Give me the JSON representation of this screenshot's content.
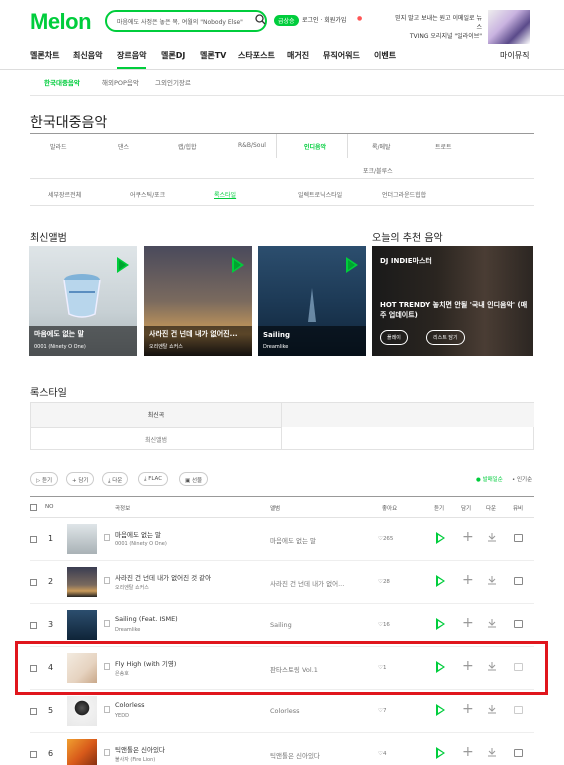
{
  "header": {
    "logo": "Melon",
    "search_text": "마음에도 사정은 놓은 목, 여월의 \"Nobody Else\"",
    "badge": "급상승",
    "login": "로그인 · 회원가입",
    "promo_line1": "믿지 말고 보내는 원고 이메일로 뉴스",
    "promo_line2": "TVING 오리지널 \"일라이브\""
  },
  "gnb": {
    "items": [
      "멜론차트",
      "최신음악",
      "장르음악",
      "멜론DJ",
      "멜론TV",
      "스타포스트",
      "매거진",
      "뮤직어워드",
      "이벤트"
    ],
    "right": "마이뮤직"
  },
  "sub_nav": [
    "한국대중음악",
    "해외POP음악",
    "그외인기장르"
  ],
  "page_title": "한국대중음악",
  "genres_row1": [
    "발라드",
    "댄스",
    "랩/힙합",
    "R&B/Soul",
    "인디음악",
    "록/메탈",
    "트로트"
  ],
  "genres_row2": [
    "포크/블루스"
  ],
  "detail_genres": [
    "세부장르전체",
    "어쿠스틱/포크",
    "록스타일",
    "일렉트로닉스타일",
    "언더그라운드힙합"
  ],
  "section_recent": "최신앨범",
  "section_today": "오늘의 추천 음악",
  "albums": [
    {
      "title": "마음에도 없는 말",
      "artist": "0001 (Ninety O One)"
    },
    {
      "title": "사라진 건 넌데 내가 없어진...",
      "artist": "오리엔탈 쇼커스"
    },
    {
      "title": "Sailing",
      "artist": "Dreamlike"
    }
  ],
  "recommend": {
    "dj_label": "DJ",
    "dj_name": "INDIE마스터",
    "title": "HOT TRENDY 놓치면 안될 '국내 인디음악' (매주 업데이트)",
    "btn1": "플레이",
    "btn2": "리스트 담기"
  },
  "section_rock": "록스타일",
  "tabs": {
    "tab1": "최신곡",
    "tab2": "최신앨범"
  },
  "actions": {
    "listen": "듣기",
    "add": "담기",
    "download": "다운",
    "flac": "FLAC",
    "gift": "선물",
    "sort_latest": "발매일순",
    "sort_popular": "인기순"
  },
  "table": {
    "headers": {
      "no": "NO",
      "song": "곡정보",
      "album": "앨범",
      "like": "좋아요",
      "listen": "듣기",
      "add": "담기",
      "download": "다운",
      "mv": "뮤비"
    },
    "rows": [
      {
        "no": "1",
        "title": "마음에도 없는 말",
        "artist": "0001 (Ninety O One)",
        "album": "마음에도 없는 말",
        "likes": "265"
      },
      {
        "no": "2",
        "title": "사라진 건 넌데 내가 없어진 것 같아",
        "artist": "오리엔탈 쇼커스",
        "album": "사라진 건 넌데 내가 없어...",
        "likes": "28"
      },
      {
        "no": "3",
        "title": "Sailing (Feat. ISME)",
        "artist": "Dreamlike",
        "album": "Sailing",
        "likes": "16"
      },
      {
        "no": "4",
        "title": "Fly High (with 기영)",
        "artist": "은송호",
        "album": "판타스토링 Vol.1",
        "likes": "1"
      },
      {
        "no": "5",
        "title": "Colorless",
        "artist": "YEDD",
        "album": "Colorless",
        "likes": "7"
      },
      {
        "no": "6",
        "title": "틱앤톨은 신아있다",
        "artist": "불사자 (Fire Lion)",
        "album": "틱앤톨은 신아있다",
        "likes": "4"
      }
    ]
  },
  "colors": {
    "accent": "#00cd3c",
    "highlight": "#e0161d"
  }
}
